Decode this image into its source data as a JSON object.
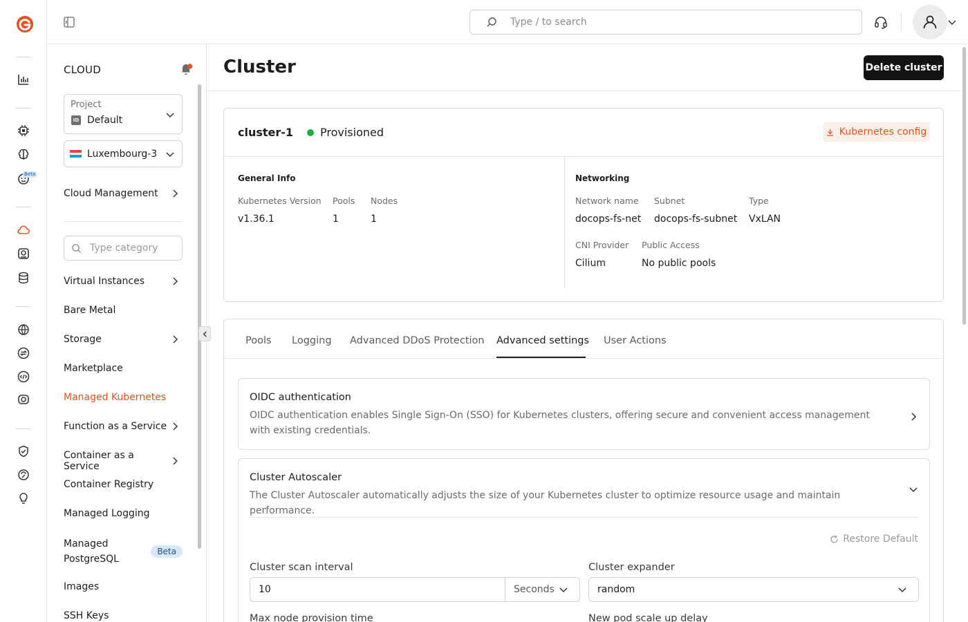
{
  "header": {
    "search_placeholder": "Type / to search"
  },
  "rail": {
    "icons": [
      "analytics-icon",
      "ai-chip-icon",
      "brain-icon",
      "bot-icon",
      "cloud-icon",
      "storage-disk-icon",
      "database-icon",
      "globe-icon",
      "transfer-icon",
      "code-icon",
      "stream-icon",
      "shield-check-icon",
      "support-icon",
      "bulb-icon"
    ],
    "beta_label": "Beta"
  },
  "sidebar": {
    "title": "CLOUD",
    "project": {
      "label": "Project",
      "value": "Default",
      "badge": "ID"
    },
    "region": {
      "value": "Luxembourg-3"
    },
    "cloud_management": "Cloud Management",
    "category_placeholder": "Type category",
    "items": [
      {
        "label": "Virtual Instances"
      },
      {
        "label": "Bare Metal"
      },
      {
        "label": "Storage"
      },
      {
        "label": "Marketplace"
      },
      {
        "label": "Managed Kubernetes"
      },
      {
        "label": "Function as a Service"
      },
      {
        "label": "Container as a Service"
      },
      {
        "label": "Container Registry"
      },
      {
        "label": "Managed Logging"
      },
      {
        "label": "Managed PostgreSQL",
        "label_line1": "Managed",
        "label_line2": "PostgreSQL",
        "badge": "Beta"
      },
      {
        "label": "Images"
      },
      {
        "label": "SSH Keys"
      }
    ],
    "active_item": "Managed Kubernetes"
  },
  "page": {
    "title": "Cluster",
    "delete_button": "Delete cluster"
  },
  "cluster": {
    "name": "cluster-1",
    "status": "Provisioned",
    "kube_config_button": "Kubernetes config",
    "general_info": {
      "title": "General Info",
      "k8s_version_label": "Kubernetes Version",
      "k8s_version": "v1.36.1",
      "pools_label": "Pools",
      "pools": "1",
      "nodes_label": "Nodes",
      "nodes": "1"
    },
    "networking": {
      "title": "Networking",
      "network_name_label": "Network name",
      "network_name": "docops-fs-net",
      "subnet_label": "Subnet",
      "subnet": "docops-fs-subnet",
      "type_label": "Type",
      "type": "VxLAN",
      "cni_label": "CNI Provider",
      "cni": "Cilium",
      "public_access_label": "Public Access",
      "public_access": "No public pools"
    }
  },
  "tabs": {
    "items": [
      "Pools",
      "Logging",
      "Advanced DDoS Protection",
      "Advanced settings",
      "User Actions"
    ],
    "active": "Advanced settings"
  },
  "advanced": {
    "oidc": {
      "title": "OIDC authentication",
      "description": "OIDC authentication enables Single Sign-On (SSO) for Kubernetes clusters, offering secure and convenient access management with existing credentials."
    },
    "autoscaler": {
      "title": "Cluster Autoscaler",
      "description": "The Cluster Autoscaler automatically adjusts the size of your Kubernetes cluster to optimize resource usage and maintain performance.",
      "restore_default": "Restore Default",
      "scan_interval_label": "Cluster scan interval",
      "scan_interval_value": "10",
      "scan_interval_unit": "Seconds",
      "expander_label": "Cluster expander",
      "expander_value": "random",
      "max_provision_label": "Max node provision time",
      "scale_up_delay_label": "New pod scale up delay"
    }
  },
  "colors": {
    "accent": "#e8501c",
    "status_green": "#1fab43",
    "beta_bg": "#d8e8fb"
  }
}
